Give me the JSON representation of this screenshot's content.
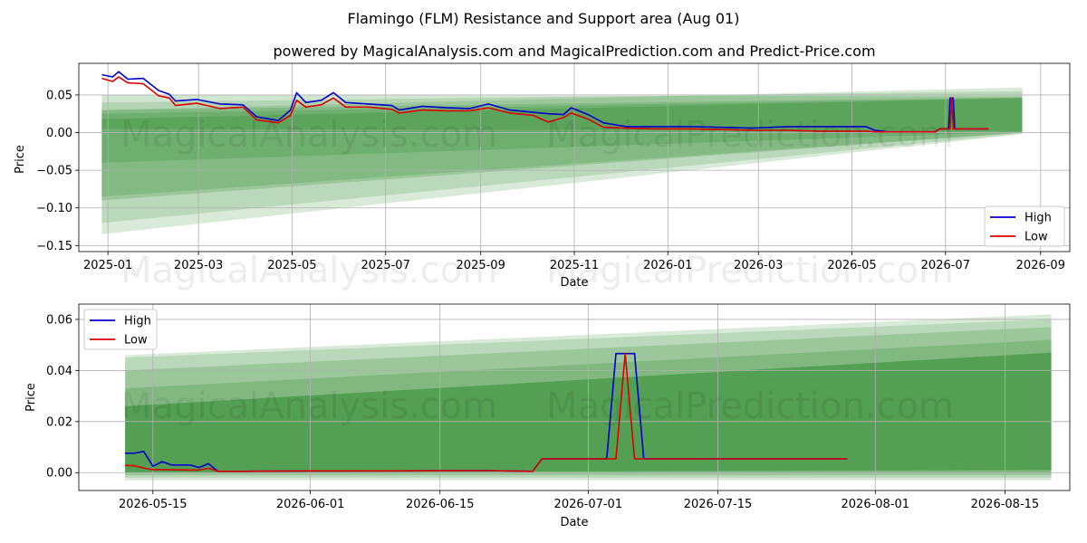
{
  "title": "Flamingo (FLM) Resistance and Support area (Aug 01)",
  "subtitle": "powered by MagicalAnalysis.com and MagicalPrediction.com and Predict-Price.com",
  "watermark_left": "MagicalAnalysis.com",
  "watermark_right": "MagicalPrediction.com",
  "colors": {
    "high": "#0000cc",
    "low": "#dd0000",
    "band": "#2e8b2e",
    "grid": "#b0b0b0"
  },
  "chart_data": [
    {
      "type": "line",
      "xlabel": "Date",
      "ylabel": "Price",
      "x_range": [
        "2024-12-13",
        "2026-09-20"
      ],
      "ylim": [
        -0.158,
        0.092
      ],
      "grid": true,
      "legend_position": "bottom-right",
      "x_ticks": [
        "2025-01-01",
        "2025-03-01",
        "2025-05-01",
        "2025-07-01",
        "2025-09-01",
        "2025-11-01",
        "2026-01-01",
        "2026-03-01",
        "2026-05-01",
        "2026-07-01",
        "2026-09-01"
      ],
      "x_tick_labels": [
        "2025-01",
        "2025-03",
        "2025-05",
        "2025-07",
        "2025-09",
        "2025-11",
        "2026-01",
        "2026-03",
        "2026-05",
        "2026-07",
        "2026-09"
      ],
      "y_ticks": [
        0.05,
        0.0,
        -0.05,
        -0.1,
        -0.15
      ],
      "y_tick_labels": [
        "0.05",
        "0.00",
        "−0.05",
        "−0.10",
        "−0.15"
      ],
      "bands": [
        {
          "x0": "2024-12-28",
          "x1": "2026-08-20",
          "lo0": -0.135,
          "hi0": 0.03,
          "lo1": -0.002,
          "hi1": 0.06,
          "alpha": 0.18
        },
        {
          "x0": "2024-12-28",
          "x1": "2026-08-20",
          "lo0": -0.12,
          "hi0": 0.04,
          "lo1": -0.001,
          "hi1": 0.055,
          "alpha": 0.18
        },
        {
          "x0": "2024-12-28",
          "x1": "2026-08-20",
          "lo0": -0.09,
          "hi0": 0.05,
          "lo1": 0.0,
          "hi1": 0.048,
          "alpha": 0.22
        },
        {
          "x0": "2024-12-28",
          "x1": "2026-08-20",
          "lo0": -0.085,
          "hi0": 0.03,
          "lo1": 0.0,
          "hi1": 0.047,
          "alpha": 0.22
        },
        {
          "x0": "2024-12-28",
          "x1": "2026-08-20",
          "lo0": -0.04,
          "hi0": 0.025,
          "lo1": 0.001,
          "hi1": 0.046,
          "alpha": 0.25
        },
        {
          "x0": "2024-12-28",
          "x1": "2026-08-20",
          "lo0": 0.005,
          "hi0": 0.018,
          "lo1": 0.002,
          "hi1": 0.046,
          "alpha": 0.28
        }
      ],
      "series": [
        {
          "name": "High",
          "color": "#0000cc",
          "points": [
            [
              "2024-12-28",
              0.077
            ],
            [
              "2025-01-04",
              0.074
            ],
            [
              "2025-01-08",
              0.081
            ],
            [
              "2025-01-14",
              0.071
            ],
            [
              "2025-01-24",
              0.072
            ],
            [
              "2025-02-03",
              0.056
            ],
            [
              "2025-02-10",
              0.051
            ],
            [
              "2025-02-14",
              0.042
            ],
            [
              "2025-02-28",
              0.044
            ],
            [
              "2025-03-15",
              0.038
            ],
            [
              "2025-03-30",
              0.037
            ],
            [
              "2025-04-08",
              0.021
            ],
            [
              "2025-04-22",
              0.016
            ],
            [
              "2025-04-30",
              0.03
            ],
            [
              "2025-05-04",
              0.053
            ],
            [
              "2025-05-10",
              0.04
            ],
            [
              "2025-05-20",
              0.043
            ],
            [
              "2025-05-28",
              0.053
            ],
            [
              "2025-06-05",
              0.04
            ],
            [
              "2025-06-20",
              0.038
            ],
            [
              "2025-07-05",
              0.036
            ],
            [
              "2025-07-10",
              0.03
            ],
            [
              "2025-07-25",
              0.035
            ],
            [
              "2025-08-10",
              0.033
            ],
            [
              "2025-08-25",
              0.032
            ],
            [
              "2025-09-06",
              0.038
            ],
            [
              "2025-09-20",
              0.03
            ],
            [
              "2025-10-05",
              0.027
            ],
            [
              "2025-10-15",
              0.025
            ],
            [
              "2025-10-25",
              0.024
            ],
            [
              "2025-10-30",
              0.033
            ],
            [
              "2025-11-10",
              0.024
            ],
            [
              "2025-11-20",
              0.013
            ],
            [
              "2025-12-05",
              0.008
            ],
            [
              "2025-12-25",
              0.008
            ],
            [
              "2026-01-15",
              0.008
            ],
            [
              "2026-02-05",
              0.007
            ],
            [
              "2026-02-25",
              0.006
            ],
            [
              "2026-03-20",
              0.008
            ],
            [
              "2026-04-10",
              0.008
            ],
            [
              "2026-05-10",
              0.008
            ],
            [
              "2026-05-16",
              0.003
            ],
            [
              "2026-05-25",
              0.001
            ],
            [
              "2026-06-24",
              0.001
            ],
            [
              "2026-06-27",
              0.005
            ],
            [
              "2026-07-03",
              0.005
            ],
            [
              "2026-07-04",
              0.046
            ],
            [
              "2026-07-06",
              0.046
            ],
            [
              "2026-07-07",
              0.005
            ],
            [
              "2026-07-29",
              0.005
            ]
          ]
        },
        {
          "name": "Low",
          "color": "#dd0000",
          "points": [
            [
              "2024-12-28",
              0.072
            ],
            [
              "2025-01-04",
              0.068
            ],
            [
              "2025-01-08",
              0.074
            ],
            [
              "2025-01-14",
              0.066
            ],
            [
              "2025-01-24",
              0.065
            ],
            [
              "2025-02-03",
              0.049
            ],
            [
              "2025-02-10",
              0.046
            ],
            [
              "2025-02-14",
              0.036
            ],
            [
              "2025-02-28",
              0.039
            ],
            [
              "2025-03-15",
              0.032
            ],
            [
              "2025-03-30",
              0.034
            ],
            [
              "2025-04-08",
              0.017
            ],
            [
              "2025-04-22",
              0.013
            ],
            [
              "2025-04-30",
              0.023
            ],
            [
              "2025-05-04",
              0.043
            ],
            [
              "2025-05-10",
              0.034
            ],
            [
              "2025-05-20",
              0.037
            ],
            [
              "2025-05-28",
              0.046
            ],
            [
              "2025-06-05",
              0.034
            ],
            [
              "2025-06-20",
              0.034
            ],
            [
              "2025-07-05",
              0.031
            ],
            [
              "2025-07-10",
              0.026
            ],
            [
              "2025-07-25",
              0.03
            ],
            [
              "2025-08-10",
              0.029
            ],
            [
              "2025-08-25",
              0.029
            ],
            [
              "2025-09-06",
              0.033
            ],
            [
              "2025-09-20",
              0.026
            ],
            [
              "2025-10-05",
              0.023
            ],
            [
              "2025-10-15",
              0.014
            ],
            [
              "2025-10-25",
              0.02
            ],
            [
              "2025-10-30",
              0.026
            ],
            [
              "2025-11-10",
              0.018
            ],
            [
              "2025-11-20",
              0.007
            ],
            [
              "2025-12-05",
              0.006
            ],
            [
              "2025-12-25",
              0.005
            ],
            [
              "2026-01-15",
              0.005
            ],
            [
              "2026-02-05",
              0.004
            ],
            [
              "2026-02-25",
              0.003
            ],
            [
              "2026-03-20",
              0.003
            ],
            [
              "2026-04-10",
              0.002
            ],
            [
              "2026-05-10",
              0.002
            ],
            [
              "2026-05-16",
              0.001
            ],
            [
              "2026-05-25",
              0.001
            ],
            [
              "2026-06-24",
              0.001
            ],
            [
              "2026-06-27",
              0.005
            ],
            [
              "2026-07-04",
              0.005
            ],
            [
              "2026-07-05",
              0.046
            ],
            [
              "2026-07-06",
              0.005
            ],
            [
              "2026-07-29",
              0.005
            ]
          ]
        }
      ]
    },
    {
      "type": "line",
      "xlabel": "Date",
      "ylabel": "Price",
      "x_range": [
        "2026-05-07",
        "2026-08-22"
      ],
      "ylim": [
        -0.007,
        0.066
      ],
      "grid": true,
      "legend_position": "top-left",
      "x_ticks": [
        "2026-05-15",
        "2026-06-01",
        "2026-06-15",
        "2026-07-01",
        "2026-07-15",
        "2026-08-01",
        "2026-08-15"
      ],
      "x_tick_labels": [
        "2026-05-15",
        "2026-06-01",
        "2026-06-15",
        "2026-07-01",
        "2026-07-15",
        "2026-08-01",
        "2026-08-15"
      ],
      "y_ticks": [
        0.0,
        0.02,
        0.04,
        0.06
      ],
      "y_tick_labels": [
        "0.00",
        "0.02",
        "0.04",
        "0.06"
      ],
      "bands": [
        {
          "x0": "2026-05-12",
          "x1": "2026-08-20",
          "lo0": -0.003,
          "hi0": 0.046,
          "lo1": -0.003,
          "hi1": 0.062,
          "alpha": 0.18
        },
        {
          "x0": "2026-05-12",
          "x1": "2026-08-20",
          "lo0": -0.002,
          "hi0": 0.045,
          "lo1": -0.002,
          "hi1": 0.06,
          "alpha": 0.18
        },
        {
          "x0": "2026-05-12",
          "x1": "2026-08-20",
          "lo0": -0.001,
          "hi0": 0.04,
          "lo1": -0.001,
          "hi1": 0.057,
          "alpha": 0.22
        },
        {
          "x0": "2026-05-12",
          "x1": "2026-08-20",
          "lo0": 0.0,
          "hi0": 0.033,
          "lo1": 0.0,
          "hi1": 0.052,
          "alpha": 0.25
        },
        {
          "x0": "2026-05-12",
          "x1": "2026-08-20",
          "lo0": 0.0,
          "hi0": 0.026,
          "lo1": 0.001,
          "hi1": 0.047,
          "alpha": 0.55
        }
      ],
      "series": [
        {
          "name": "High",
          "color": "#0000cc",
          "points": [
            [
              "2026-05-12",
              0.0076
            ],
            [
              "2026-05-13",
              0.0076
            ],
            [
              "2026-05-14",
              0.0083
            ],
            [
              "2026-05-15",
              0.0025
            ],
            [
              "2026-05-16",
              0.0043
            ],
            [
              "2026-05-17",
              0.003
            ],
            [
              "2026-05-18",
              0.003
            ],
            [
              "2026-05-19",
              0.003
            ],
            [
              "2026-05-20",
              0.002
            ],
            [
              "2026-05-21",
              0.0035
            ],
            [
              "2026-05-22",
              0.0005
            ],
            [
              "2026-05-25",
              0.0005
            ],
            [
              "2026-06-01",
              0.0007
            ],
            [
              "2026-06-10",
              0.0007
            ],
            [
              "2026-06-20",
              0.0008
            ],
            [
              "2026-06-25",
              0.0005
            ],
            [
              "2026-06-26",
              0.0054
            ],
            [
              "2026-07-03",
              0.0054
            ],
            [
              "2026-07-04",
              0.0466
            ],
            [
              "2026-07-06",
              0.0466
            ],
            [
              "2026-07-07",
              0.0054
            ],
            [
              "2026-07-29",
              0.0054
            ]
          ]
        },
        {
          "name": "Low",
          "color": "#dd0000",
          "points": [
            [
              "2026-05-12",
              0.0028
            ],
            [
              "2026-05-13",
              0.0027
            ],
            [
              "2026-05-14",
              0.0018
            ],
            [
              "2026-05-15",
              0.0012
            ],
            [
              "2026-05-20",
              0.001
            ],
            [
              "2026-05-21",
              0.0017
            ],
            [
              "2026-05-22",
              0.0005
            ],
            [
              "2026-05-25",
              0.0005
            ],
            [
              "2026-06-01",
              0.0007
            ],
            [
              "2026-06-10",
              0.0007
            ],
            [
              "2026-06-20",
              0.0008
            ],
            [
              "2026-06-25",
              0.0005
            ],
            [
              "2026-06-26",
              0.0054
            ],
            [
              "2026-07-04",
              0.0054
            ],
            [
              "2026-07-05",
              0.0466
            ],
            [
              "2026-07-06",
              0.0054
            ],
            [
              "2026-07-29",
              0.0054
            ]
          ]
        }
      ]
    }
  ]
}
